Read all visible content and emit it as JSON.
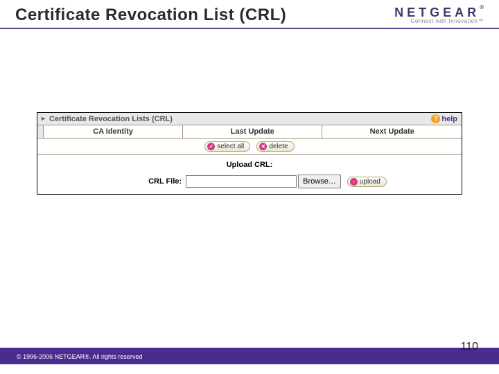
{
  "header": {
    "title": "Certificate Revocation List (CRL)",
    "brand_name": "NETGEAR",
    "brand_reg": "®",
    "brand_tagline": "Connect with Innovation™"
  },
  "panel": {
    "title": "Certificate Revocation Lists (CRL)",
    "help_label": "help",
    "disclosure_symbol": "▸",
    "columns": {
      "checkbox": "",
      "ca_identity": "CA Identity",
      "last_update": "Last Update",
      "next_update": "Next Update"
    },
    "actions": {
      "select_all": "select all",
      "delete": "delete"
    },
    "upload": {
      "section_title": "Upload CRL:",
      "file_label": "CRL File:",
      "file_value": "",
      "browse_label": "Browse…",
      "upload_label": "upload"
    }
  },
  "footer": {
    "copyright": "© 1996-2006 NETGEAR®. All rights reserved",
    "page_number": "110"
  }
}
